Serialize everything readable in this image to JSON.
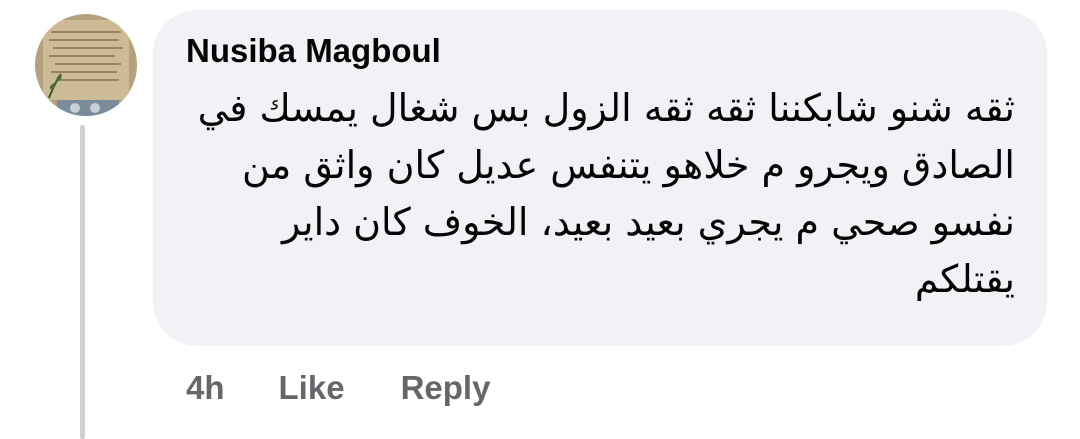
{
  "comment": {
    "author": "Nusiba Magboul",
    "text_lines": [
      "ثقه شنو شابكننا ثقه ثقه الزول بس شغال يمسك في",
      "الصادق ويجرو م خلاهو يتنفس عديل كان واثق من",
      "نفسو صحي م يجري بعيد بعيد، الخوف كان داير",
      "يقتلكم"
    ],
    "timestamp": "4h",
    "like_label": "Like",
    "reply_label": "Reply"
  },
  "colors": {
    "bubble_bg": "#f0f2f5",
    "text": "#050505",
    "secondary_text": "#65676b",
    "thread_line": "#ced0d4"
  },
  "icons": {
    "avatar": "profile-photo-parchment"
  }
}
